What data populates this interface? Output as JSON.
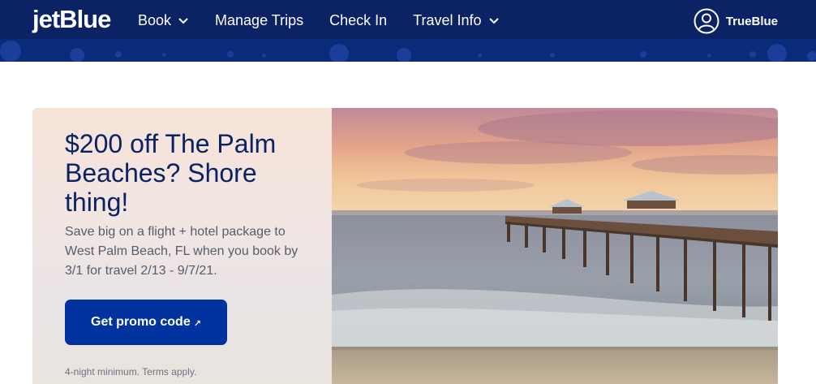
{
  "brand": {
    "logo_text": "jetBlue"
  },
  "nav": {
    "items": [
      {
        "label": "Book",
        "has_dropdown": true
      },
      {
        "label": "Manage Trips",
        "has_dropdown": false
      },
      {
        "label": "Check In",
        "has_dropdown": false
      },
      {
        "label": "Travel Info",
        "has_dropdown": true
      }
    ]
  },
  "account": {
    "label": "TrueBlue",
    "icon": "user-circle-icon"
  },
  "promo": {
    "headline": "$200 off The Palm Beaches? Shore thing!",
    "description": "Save big on a flight + hotel package to West Palm Beach, FL when you book by 3/1 for travel 2/13 - 9/7/21.",
    "button_label": "Get promo code",
    "button_icon": "external-link-icon",
    "fine_print": "4-night minimum. Terms apply.",
    "image": "beach-pier-sunset-photo"
  },
  "colors": {
    "header_bg": "#0b2265",
    "headline": "#0b2265",
    "button_bg": "#0033a0",
    "button_text": "#ffffff"
  }
}
